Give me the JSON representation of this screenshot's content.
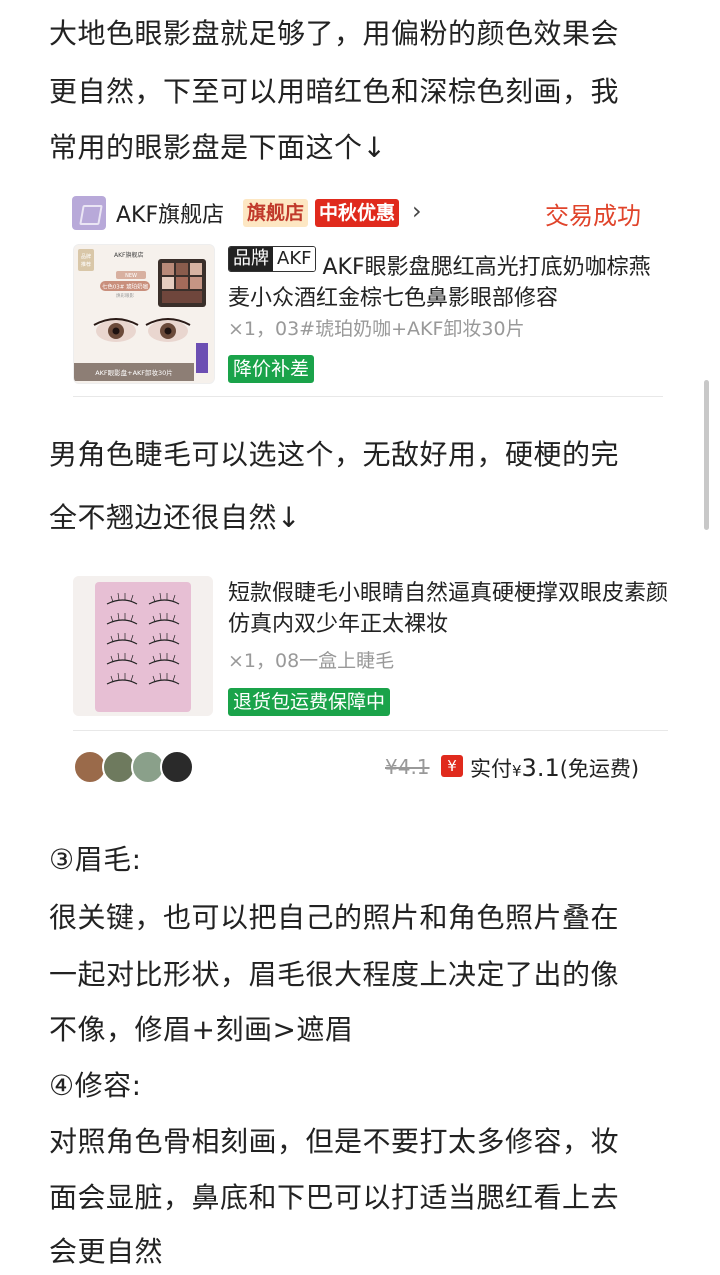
{
  "intro": {
    "line1": "大地色眼影盘就足够了，用偏粉的颜色效果会",
    "line2": "更自然，下至可以用暗红色和深棕色刻画，我",
    "line3": "常用的眼影盘是下面这个↓"
  },
  "order1": {
    "store_name": "AKF旗舰店",
    "tag_flagship": "旗舰店",
    "tag_festival": "中秋优惠",
    "chevron": "›",
    "status": "交易成功",
    "brand_label": "品牌",
    "brand_name": "AKF",
    "title": "AKF眼影盘腮红高光打底奶咖棕燕麦小众酒红金棕七色鼻影眼部修容",
    "spec": "×1，03#琥珀奶咖+AKF卸妆30片",
    "badge": "降价补差",
    "thumb_text": {
      "badge": "品牌\n推荐",
      "brand": "AKF旗舰店",
      "new": "NEW",
      "line1": "七色03# 琥珀奶咖",
      "line2": "焕彩眼影",
      "bottom": "AKF眼影盘+AKF卸妆30片"
    }
  },
  "middle": {
    "line1": "男角色睫毛可以选这个，无敌好用，硬梗的完",
    "line2": "全不翘边还很自然↓"
  },
  "order2": {
    "title": "短款假睫毛小眼睛自然逼真硬梗撑双眼皮素颜仿真内双少年正太裸妆",
    "spec": "×1，08一盒上睫毛",
    "badge": "退货包运费保障中",
    "original_price": "¥4.1",
    "pay_icon": "¥",
    "paid_label": "实付",
    "currency": "¥",
    "paid_amount": "3.1",
    "shipping": "(免运费)"
  },
  "tips": {
    "eyebrow_heading": "③眉毛:",
    "eyebrow_line1": "很关键，也可以把自己的照片和角色照片叠在",
    "eyebrow_line2": "一起对比形状，眉毛很大程度上决定了出的像",
    "eyebrow_line3": "不像，修眉+刻画>遮眉",
    "contour_heading": "④修容:",
    "contour_line1": "对照角色骨相刻画，但是不要打太多修容，妆",
    "contour_line2": "面会显脏，鼻底和下巴可以打适当腮红看上去",
    "contour_line3": "会更自然"
  },
  "colors": {
    "status_red": "#e0442b",
    "badge_green": "#1aa34a",
    "festival_red": "#e02a1d"
  }
}
